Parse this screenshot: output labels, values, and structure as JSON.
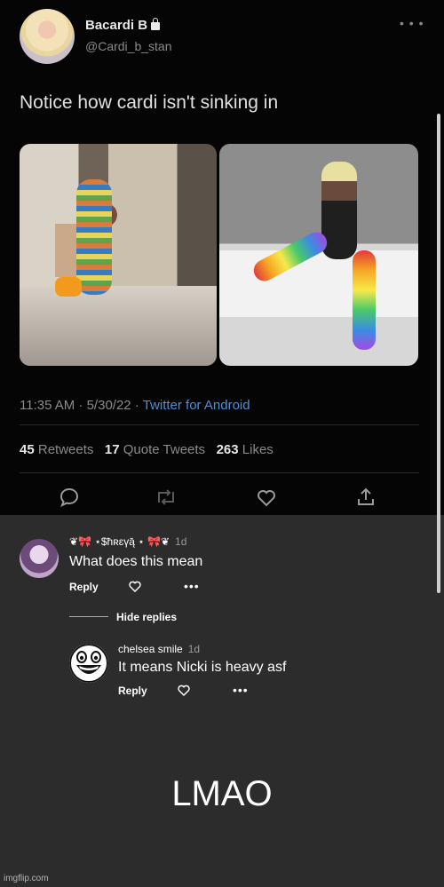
{
  "tweet": {
    "name": "Bacardi B",
    "handle": "@Cardi_b_stan",
    "text": "Notice how cardi isn't sinking in",
    "timestamp": "11:35 AM · 5/30/22 · ",
    "source": "Twitter for Android",
    "retweets_count": "45",
    "retweets_label": "Retweets",
    "quotes_count": "17",
    "quotes_label": "Quote Tweets",
    "likes_count": "263",
    "likes_label": "Likes",
    "actions": [
      "reply-icon",
      "retweet-icon",
      "like-icon",
      "share-icon"
    ]
  },
  "comments": {
    "first": {
      "username": "❦🎀 ⋆$ħʀɛүą̄ ⋆ 🎀❦",
      "time": "1d",
      "text": "What does this mean",
      "reply_label": "Reply",
      "more": "•••"
    },
    "hide_replies": "Hide replies",
    "reply": {
      "username": "chelsea smile",
      "time": "1d",
      "text": "It means Nicki is heavy asf",
      "reply_label": "Reply",
      "more": "•••"
    }
  },
  "caption": "LMAO",
  "watermark": "imgflip.com",
  "colors": {
    "tweet_bg": "#050505",
    "comment_bg": "#2c2c2c",
    "link": "#4a90d9"
  }
}
